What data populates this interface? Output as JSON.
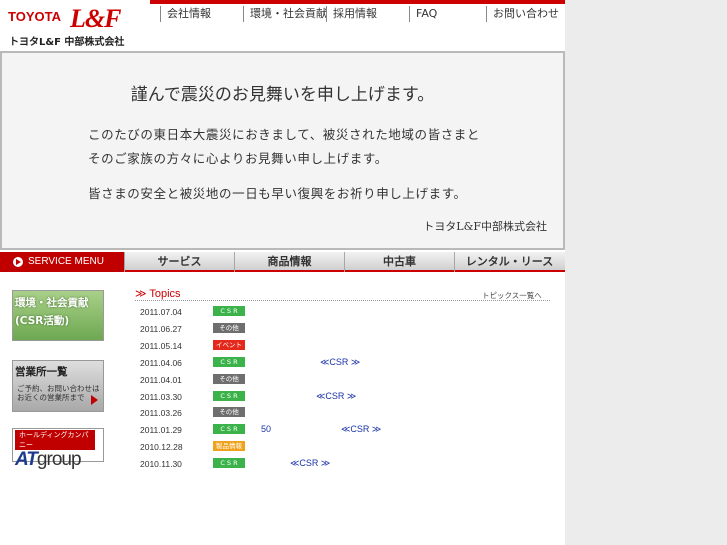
{
  "brand": {
    "toyota": "TOYOTA",
    "lf": "L&F",
    "subtitle": "トヨタL&F 中部株式会社",
    "accent": "#cc0000"
  },
  "global_nav": [
    "会社情報",
    "環境・社会貢献",
    "採用情報",
    "FAQ",
    "お問い合わせ"
  ],
  "notice": {
    "title": "謹んで震災のお見舞いを申し上げます。",
    "p1": "このたびの東日本大震災におきまして、被災された地域の皆さまと",
    "p2": "そのご家族の方々に心よりお見舞い申し上げます。",
    "p3": "皆さまの安全と被災地の一日も早い復興をお祈り申し上げます。",
    "signature": "トヨタL&F中部株式会社"
  },
  "service_menu": {
    "label": "SERVICE MENU",
    "tabs": [
      "サービス",
      "商品情報",
      "中古車",
      "レンタル・リース"
    ]
  },
  "banners": {
    "csr_line1": "環境・社会貢献",
    "csr_line2": "(CSR活動)",
    "office_line1": "営業所一覧",
    "office_line2a": "ご予約、お問い合わせは",
    "office_line2b": "お近くの営業所まで",
    "at_line1": "ホールディングカンパニー",
    "at_brand": "AT",
    "at_word": "group"
  },
  "topics": {
    "heading": "Topics",
    "more_link": "トピックス一覧へ",
    "items": [
      {
        "date": "2011.07.04",
        "badge": "C S R",
        "badge_color": "#3cb34a",
        "text": ""
      },
      {
        "date": "2011.06.27",
        "badge": "その他",
        "badge_color": "#6e6e6e",
        "text": ""
      },
      {
        "date": "2011.05.14",
        "badge": "イベント",
        "badge_color": "#e5281c",
        "text": ""
      },
      {
        "date": "2011.04.06",
        "badge": "C S R",
        "badge_color": "#3cb34a",
        "text": "≪CSR ≫"
      },
      {
        "date": "2011.04.01",
        "badge": "その他",
        "badge_color": "#6e6e6e",
        "text": ""
      },
      {
        "date": "2011.03.30",
        "badge": "C S R",
        "badge_color": "#3cb34a",
        "text": "≪CSR ≫"
      },
      {
        "date": "2011.03.26",
        "badge": "その他",
        "badge_color": "#6e6e6e",
        "text": ""
      },
      {
        "date": "2011.01.29",
        "badge": "C S R",
        "badge_color": "#3cb34a",
        "text": "50",
        "text2": "≪CSR ≫"
      },
      {
        "date": "2010.12.28",
        "badge": "製品情報",
        "badge_color": "#f0a21c",
        "text": ""
      },
      {
        "date": "2010.11.30",
        "badge": "C S R",
        "badge_color": "#3cb34a",
        "text": "≪CSR ≫"
      }
    ]
  }
}
